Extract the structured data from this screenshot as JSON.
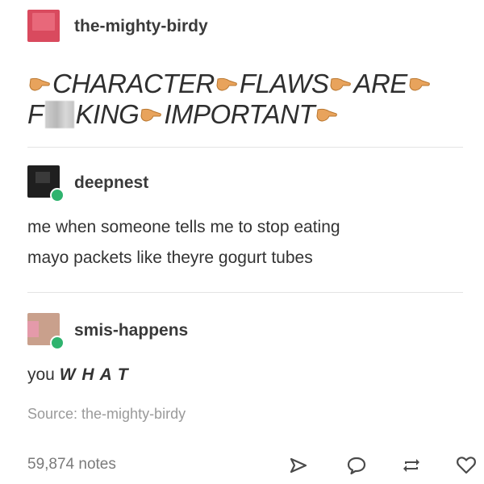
{
  "post": {
    "original": {
      "username": "the-mighty-birdy",
      "shout_words": [
        "CHARACTER",
        "FLAWS",
        "ARE",
        "F",
        "KING",
        "IMPORTANT"
      ],
      "emoji": "pointing-finger-emoji",
      "censor": "blurred-censor-block"
    },
    "reblog1": {
      "username": "deepnest",
      "text_line1": "me when someone tells me to stop eating",
      "text_line2": "mayo packets like theyre gogurt tubes"
    },
    "reblog2": {
      "username": "smis-happens",
      "text_prefix": "you ",
      "text_bold": "W H A T"
    },
    "source": {
      "label": "Source: the-mighty-birdy"
    },
    "footer": {
      "notes": "59,874 notes",
      "actions": [
        "share-icon",
        "reply-icon",
        "reblog-icon",
        "like-icon"
      ]
    }
  },
  "colors": {
    "avatar_original": "#d94a5e",
    "avatar_deepnest": "#1f1f1f",
    "avatar_smis": "#c9a08c",
    "badge_green": "#2fb36e",
    "emoji_skin": "#e8a35c",
    "muted_text": "#9a9a9a",
    "divider": "#e4e4e4"
  }
}
